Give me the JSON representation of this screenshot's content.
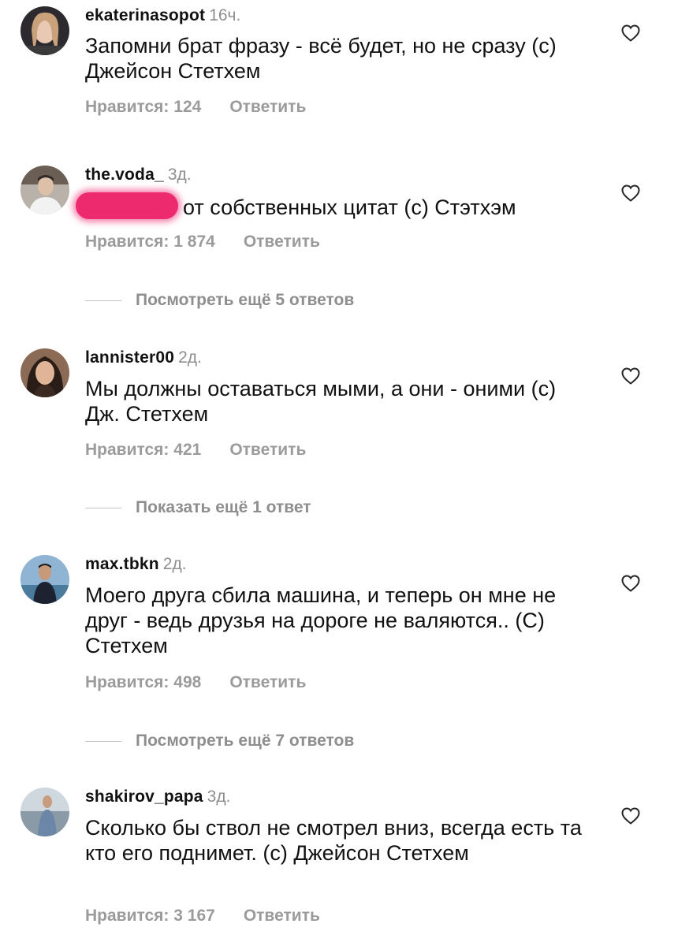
{
  "colors": {
    "username": "#111111",
    "secondary": "#8e8e8e",
    "meta": "#9b9b9b",
    "redaction": "#ee2a6f"
  },
  "comments": [
    {
      "username": "ekaterinasopot",
      "time": "16ч.",
      "text": "Запомни брат фразу - всё будет, но не сразу (с) Джейсон Стетхем",
      "likes": "Нравится: 124",
      "reply": "Ответить",
      "avatar_icon": "user-avatar-photo"
    },
    {
      "username": "the.voda_",
      "time": "3д.",
      "text": "от собственных цитат (с) Стэтхэм",
      "likes": "Нравится: 1 874",
      "reply": "Ответить",
      "avatar_icon": "user-avatar-photo"
    },
    {
      "username": "lannister00",
      "time": "2д.",
      "text": "Мы должны оставаться мыми, а они - оними (с) Дж. Стетхем",
      "likes": "Нравится: 421",
      "reply": "Ответить",
      "avatar_icon": "user-avatar-photo"
    },
    {
      "username": "max.tbkn",
      "time": "2д.",
      "text": "Моего друга сбила машина, и теперь он мне не друг - ведь друзья на дороге не валяются.. (С) Стетхем",
      "likes": "Нравится: 498",
      "reply": "Ответить",
      "avatar_icon": "user-avatar-photo"
    },
    {
      "username": "shakirov_papa",
      "time": "3д.",
      "text": "Сколько бы ствол не смотрел вниз, всегда есть та кто его поднимет. (с) Джейсон Стетхем",
      "likes": "Нравится: 3 167",
      "reply": "Ответить",
      "avatar_icon": "user-avatar-photo"
    }
  ],
  "view_replies": [
    "Посмотреть ещё 5 ответов",
    "Показать ещё 1 ответ",
    "Посмотреть ещё 7 ответов"
  ],
  "icons": {
    "like": "heart-outline-icon"
  }
}
